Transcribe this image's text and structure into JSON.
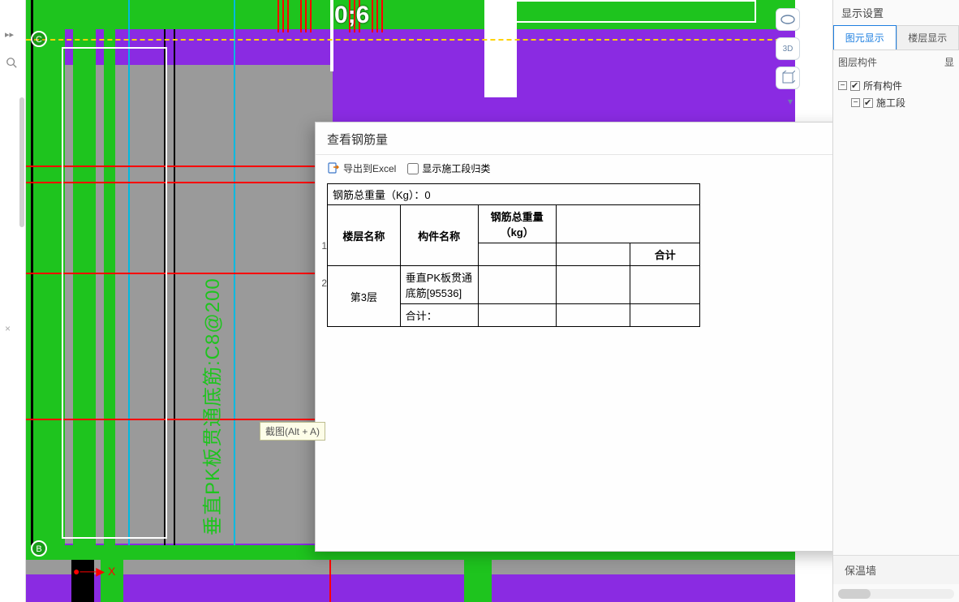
{
  "left": {
    "arrows_hint": "▸▸",
    "close_hint": "×"
  },
  "canvas": {
    "coord_label": "0;6",
    "grid_bubble_c": "C",
    "grid_bubble_b": "B",
    "axis_x": "X",
    "vertical_annotation": "垂直PK板贯通底筋:C8@200",
    "tooltip": "截图(Alt + A)"
  },
  "view_buttons": {
    "b1": "○",
    "b2": "3D",
    "b3": "□",
    "b4": "▾"
  },
  "dialog": {
    "title": "查看钢筋量",
    "export_label": "导出到Excel",
    "show_segment_label": "显示施工段归类",
    "total_line": "钢筋总重量（Kg）：0",
    "headers": {
      "floor": "楼层名称",
      "member": "构件名称",
      "weight": "钢筋总重量（kg）",
      "sum": "合计"
    },
    "rows": [
      {
        "num": "1",
        "floor": "第3层",
        "member": "垂直PK板贯通底筋[95536]",
        "weight": "",
        "sum": ""
      },
      {
        "num": "2",
        "floor": "",
        "member": "合计：",
        "weight": "",
        "sum": ""
      }
    ]
  },
  "right": {
    "section_title": "显示设置",
    "tab_active": "图元显示",
    "tab_other": "楼层显示",
    "col_hdr_left": "图层构件",
    "col_hdr_right": "显",
    "tree_root": "所有构件",
    "tree_child": "施工段",
    "bottom_label": "保温墙"
  }
}
